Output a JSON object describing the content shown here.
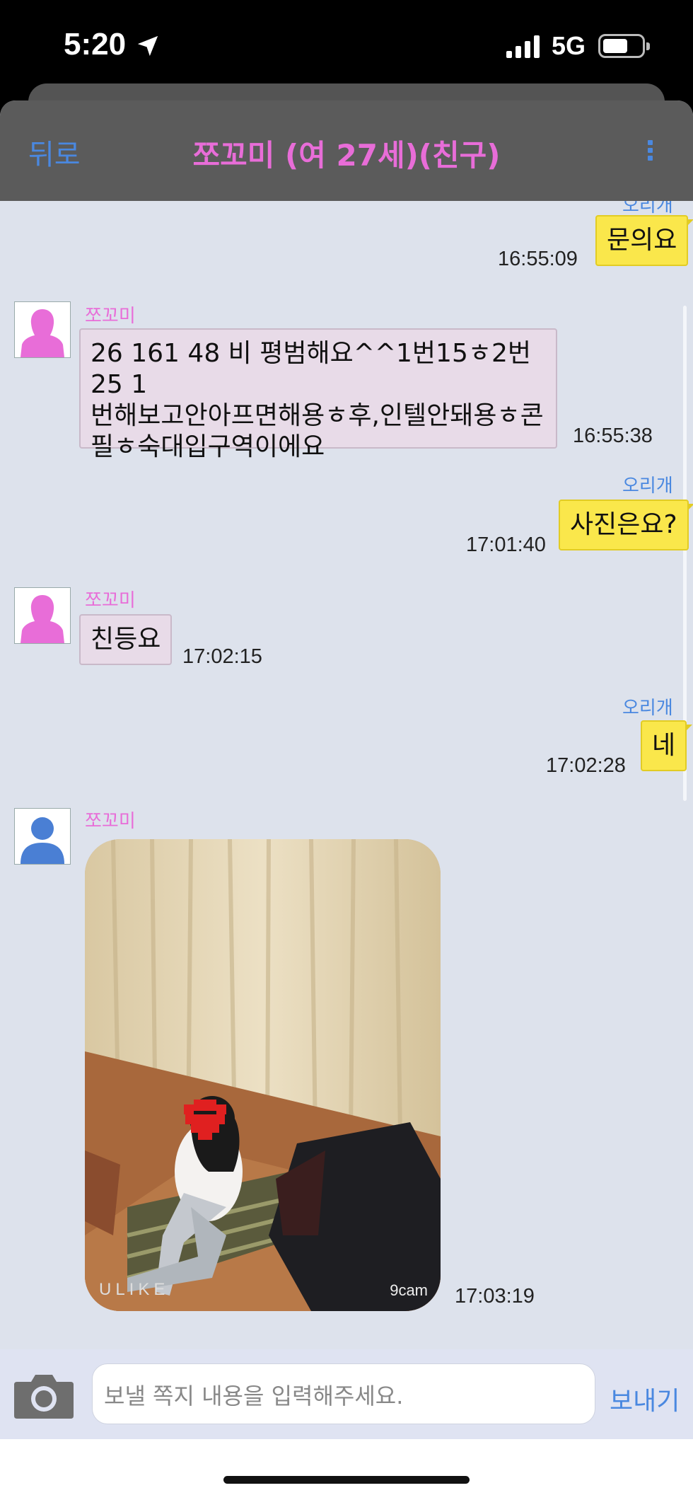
{
  "status_bar": {
    "time": "5:20",
    "network": "5G",
    "battery_level": 0.55
  },
  "header": {
    "back_label": "뒤로",
    "title": "쪼꼬미 (여 27세)(친구)",
    "more_icon": "more-vertical-icon"
  },
  "colors": {
    "accent": "#4a88e0",
    "female": "#e86dd8",
    "outgoing_bubble": "#fae74b",
    "incoming_bubble": "#e8dbe8",
    "chat_bg": "#dde2ec"
  },
  "messages": [
    {
      "direction": "out",
      "sender": "오리개",
      "text": "문의요",
      "time": "16:55:09"
    },
    {
      "direction": "in",
      "sender": "쪼꼬미",
      "lines": [
        "26 161 48 비 평범해요^^1번15ㅎ2번25 1",
        "번해보고안아프면해용ㅎ후,인텔안돼용ㅎ콘",
        "필ㅎ숙대입구역이에요"
      ],
      "time": "16:55:38"
    },
    {
      "direction": "out",
      "sender": "오리개",
      "text": "사진은요?",
      "time": "17:01:40"
    },
    {
      "direction": "in",
      "sender": "쪼꼬미",
      "text": "친등요",
      "time": "17:02:15"
    },
    {
      "direction": "out",
      "sender": "오리개",
      "text": "네",
      "time": "17:02:28"
    },
    {
      "direction": "in",
      "sender": "쪼꼬미",
      "type": "image",
      "watermark_left": "ULIKE",
      "watermark_right": "9cam",
      "time": "17:03:19"
    }
  ],
  "composer": {
    "placeholder": "보낼 쪽지 내용을 입력해주세요.",
    "send_label": "보내기",
    "camera_icon": "camera-icon"
  }
}
